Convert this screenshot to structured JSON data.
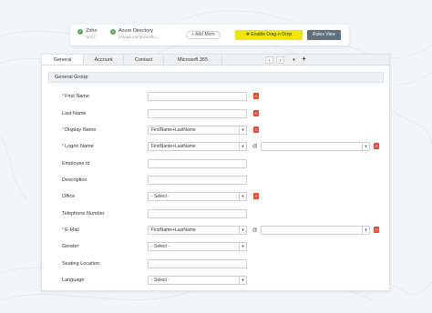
{
  "topbar": {
    "source1": {
      "name": "Zoho",
      "sub": "Hozo"
    },
    "source2": {
      "name": "Azure Directory",
      "sub": "empqa.onmicrosoft.c..."
    },
    "add_more": "+ Add More",
    "enable_drag_drop": "Enable Drag-n-Drop",
    "rules_view": "Rules View"
  },
  "tabs": [
    {
      "label": "General"
    },
    {
      "label": "Account"
    },
    {
      "label": "Contact"
    },
    {
      "label": "Microsoft 365"
    }
  ],
  "tab_controls": {
    "prev": "‹",
    "next": "›",
    "menu": "▾",
    "add": "+"
  },
  "group_title": "General Group",
  "fields": {
    "first_name": {
      "label": "First Name",
      "required": "*"
    },
    "last_name": {
      "label": "Last Name"
    },
    "display_name": {
      "label": "Display Name",
      "required": "*",
      "value": "FirstName+LastName"
    },
    "logon_name": {
      "label": "Logon Name",
      "required": "*",
      "value": "FirstName+LastName",
      "at": "@"
    },
    "employee_id": {
      "label": "Employee Id"
    },
    "description": {
      "label": "Description"
    },
    "office": {
      "label": "Office",
      "value": "- Select -"
    },
    "telephone": {
      "label": "Telephone Number"
    },
    "email": {
      "label": "E-Mail",
      "required": "*",
      "value": "FirstName+LastName",
      "at": "@"
    },
    "gender": {
      "label": "Gender",
      "value": "- Select -"
    },
    "seating_location": {
      "label": "Seating Location"
    },
    "language": {
      "label": "Language",
      "value": "- Select -"
    }
  },
  "colors": {
    "accent_yellow": "#f2e600",
    "rules_view_bg": "#5f6f7c",
    "office_icon": "#e9462c",
    "required_star": "#e53935",
    "check_green": "#4caf50"
  }
}
